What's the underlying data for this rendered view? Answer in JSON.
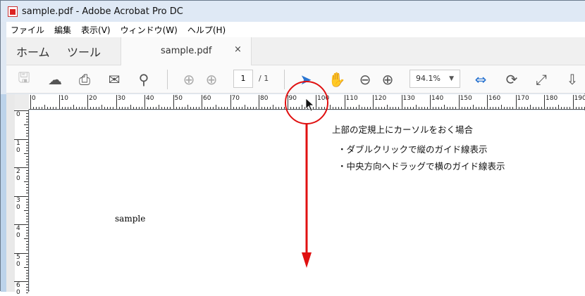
{
  "window": {
    "title": "sample.pdf - Adobe Acrobat Pro DC"
  },
  "menu": [
    "ファイル",
    "編集",
    "表示(V)",
    "ウィンドウ(W)",
    "ヘルプ(H)"
  ],
  "tabs": {
    "home": "ホーム",
    "tools": "ツール",
    "document": "sample.pdf",
    "close": "×"
  },
  "toolbar": {
    "page_current": "1",
    "page_total": "/ 1",
    "zoom": "94.1%",
    "dropdown": "▼"
  },
  "ruler": {
    "h_labels": [
      "0",
      "10",
      "20",
      "30",
      "40",
      "50",
      "60",
      "70",
      "80",
      "90",
      "100",
      "110",
      "120",
      "130",
      "140",
      "150",
      "160",
      "170",
      "180",
      "190"
    ],
    "v_labels": [
      "0",
      "10",
      "20",
      "30",
      "40",
      "50",
      "60"
    ]
  },
  "document": {
    "text": "sample"
  },
  "annotation": {
    "heading": "上部の定規上にカーソルをおく場合",
    "bullets": [
      "・ダブルクリックで縦のガイド線表示",
      "・中央方向へドラッグで横のガイド線表示"
    ],
    "color": "#e01010"
  }
}
